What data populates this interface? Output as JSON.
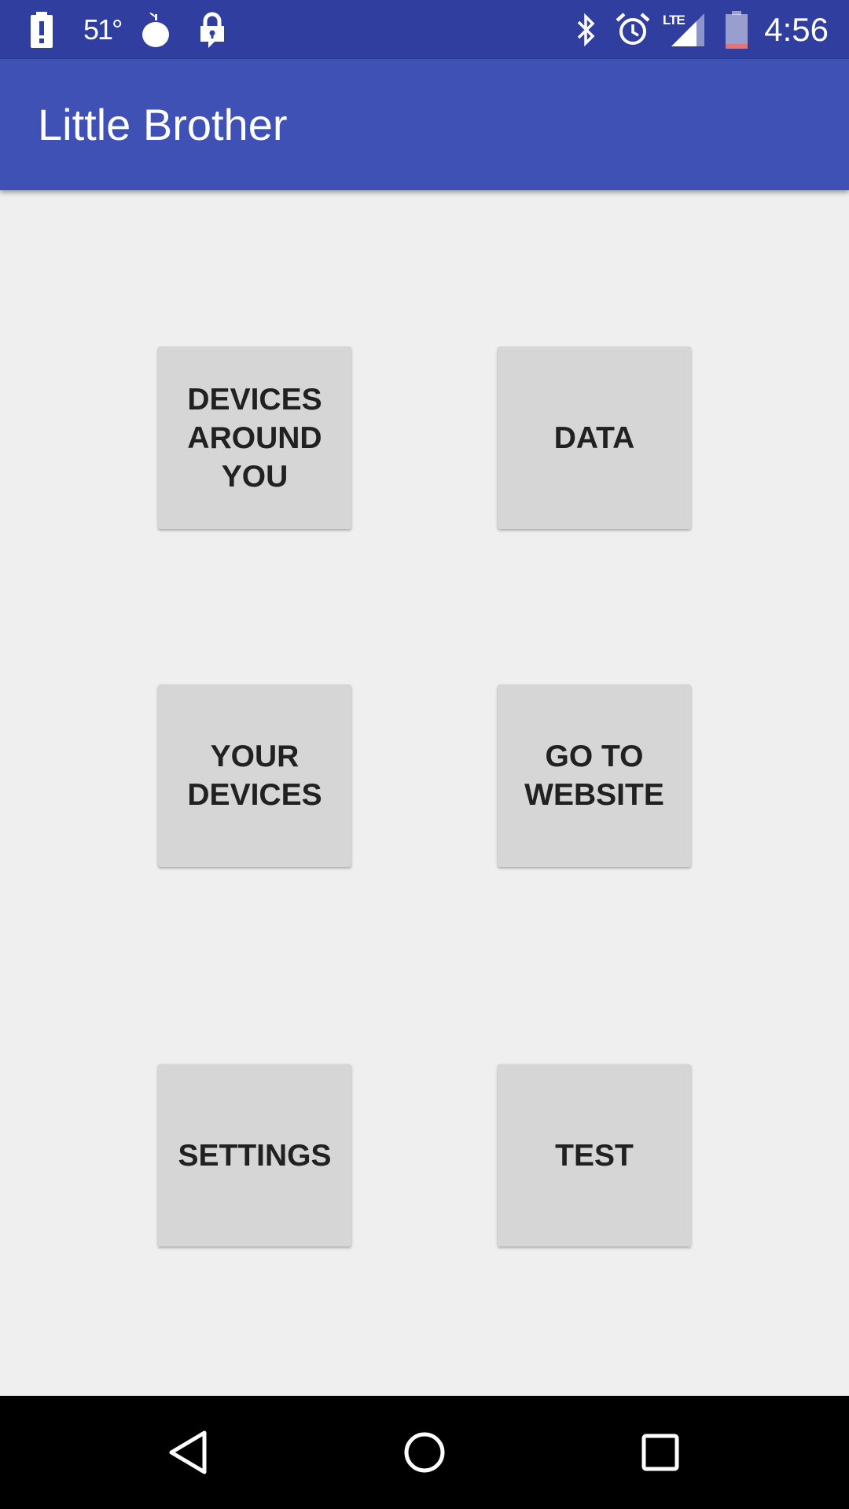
{
  "status_bar": {
    "temperature": "51°",
    "network": "LTE",
    "time": "4:56",
    "icons": [
      "alert-icon",
      "weather-icon",
      "fruit-app-icon",
      "vpn-lock-icon",
      "bluetooth-icon",
      "alarm-icon",
      "signal-icon",
      "battery-icon"
    ]
  },
  "app_bar": {
    "title": "Little Brother"
  },
  "buttons": {
    "devices_around_you": "DEVICES\nAROUND\nYOU",
    "data": "DATA",
    "your_devices": "YOUR\nDEVICES",
    "go_to_website": "GO TO\nWEBSITE",
    "settings": "SETTINGS",
    "test": "TEST"
  },
  "nav_bar": {
    "icons": [
      "back-icon",
      "home-icon",
      "recents-icon"
    ]
  },
  "colors": {
    "status_bar": "#303f9f",
    "app_bar": "#3f51b5",
    "background": "#efefef",
    "button": "#d6d6d6",
    "button_text": "#212121",
    "nav_bar": "#000000"
  }
}
